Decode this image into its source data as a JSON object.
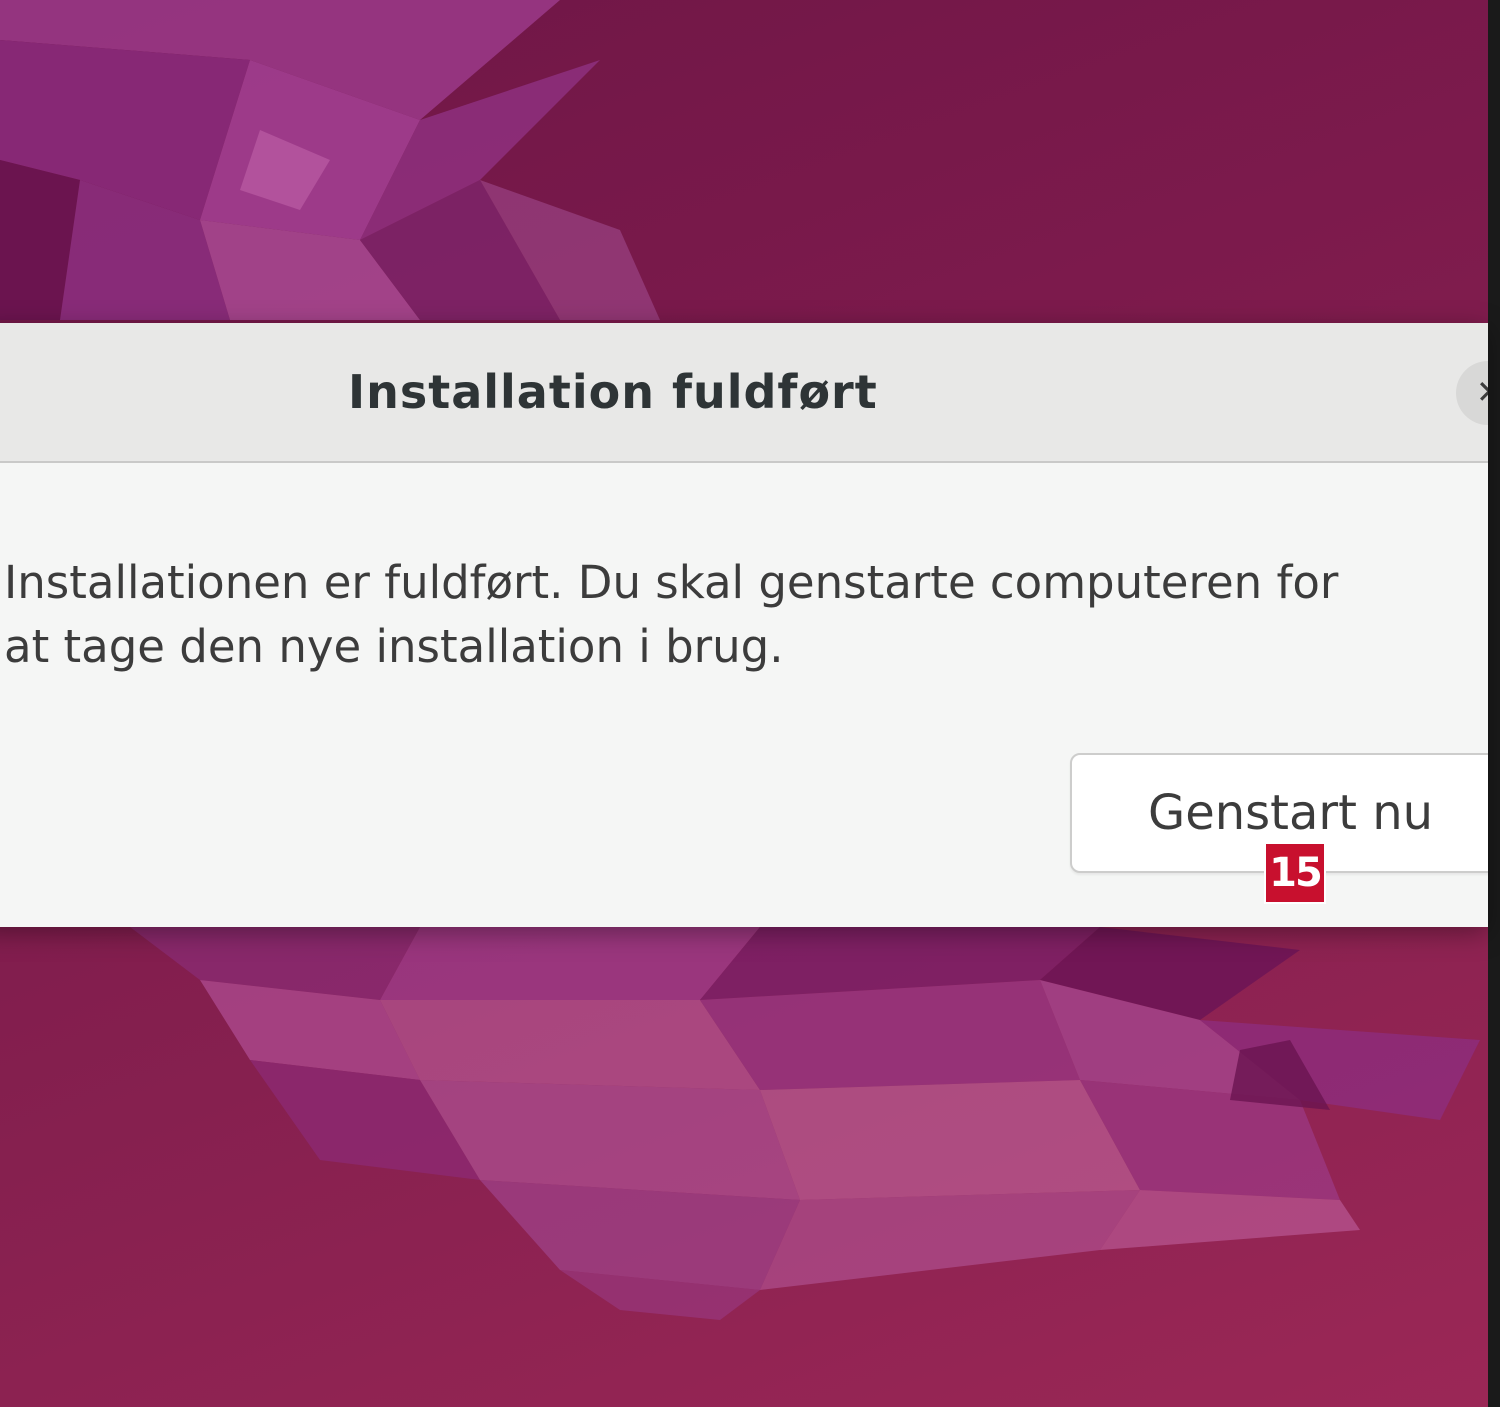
{
  "dialog": {
    "title": "Installation fuldført",
    "message_line1": "Installationen er fuldført. Du skal genstarte computeren for",
    "message_line2": "at tage den nye installation i brug.",
    "close_icon": "close-icon",
    "restart_label": "Genstart nu"
  },
  "overlay": {
    "hint_label": "15",
    "hint_color": "#c8102e"
  },
  "desktop": {
    "wallpaper_colors": [
      "#6e1646",
      "#86204f",
      "#9b2756",
      "#b04a8a"
    ]
  }
}
